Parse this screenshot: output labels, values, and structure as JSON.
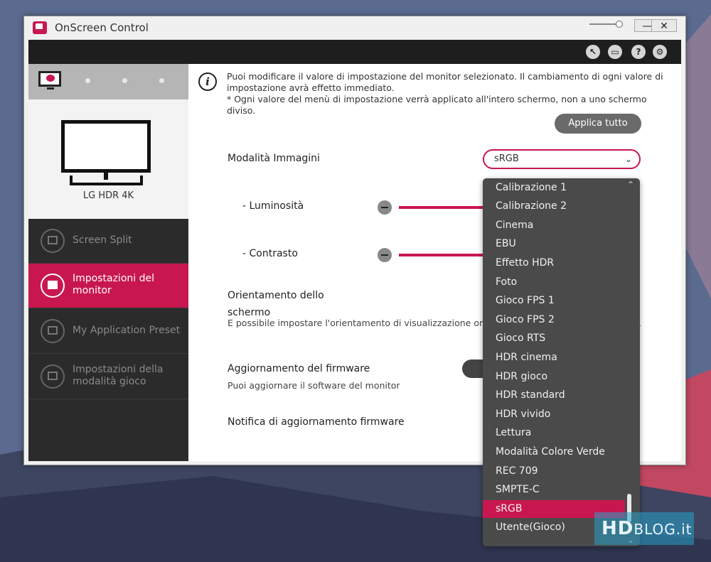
{
  "window": {
    "title": "OnScreen Control",
    "minimize": "—",
    "close": "✕"
  },
  "toolbar_icons": [
    "cursor-icon",
    "display-icon",
    "help-icon",
    "settings-icon"
  ],
  "toolbar": {
    "help": "?",
    "settings": "⚙"
  },
  "sidebar": {
    "monitor_name": "LG HDR 4K",
    "items": [
      {
        "label": "Screen Split",
        "active": false
      },
      {
        "label": "Impostazioni del monitor",
        "active": true
      },
      {
        "label": "My Application Preset",
        "active": false
      },
      {
        "label": "Impostazioni della modalità gioco",
        "active": false
      }
    ]
  },
  "content": {
    "info_line1": "Puoi modificare il valore di impostazione del monitor selezionato. Il cambiamento di ogni valore di impostazione avrà effetto immediato.",
    "info_line2": "* Ogni valore del menù di impostazione verrà applicato all'intero schermo, non a uno schermo diviso.",
    "apply_all": "Applica tutto",
    "picture_mode_label": "Modalità Immagini",
    "picture_mode_value": "sRGB",
    "brightness_label": "- Luminosità",
    "contrast_label": "- Contrasto",
    "orientation_label": "Orientamento dello schermo",
    "orientation_desc": "E possibile impostare l'orientamento di visualizzazione orizz",
    "orientation_desc_tail": ".",
    "firmware_label": "Aggiornamento del firmware",
    "firmware_desc": "Puoi aggiornare il software del monitor",
    "firmware_notify_label": "Notifica di aggiornamento firmware"
  },
  "dropdown": {
    "options": [
      "Calibrazione 1",
      "Calibrazione 2",
      "Cinema",
      "EBU",
      "Effetto HDR",
      "Foto",
      "Gioco FPS 1",
      "Gioco FPS 2",
      "Gioco RTS",
      "HDR cinema",
      "HDR gioco",
      "HDR standard",
      "HDR vivido",
      "Lettura",
      "Modalità Colore Verde",
      "REC 709",
      "SMPTE-C",
      "sRGB",
      "Utente(Gioco)"
    ],
    "selected": "sRGB"
  },
  "watermark": {
    "hd": "HD",
    "blog": "BLOG.it"
  },
  "colors": {
    "accent": "#c8174f",
    "dark": "#2b2b2b"
  }
}
